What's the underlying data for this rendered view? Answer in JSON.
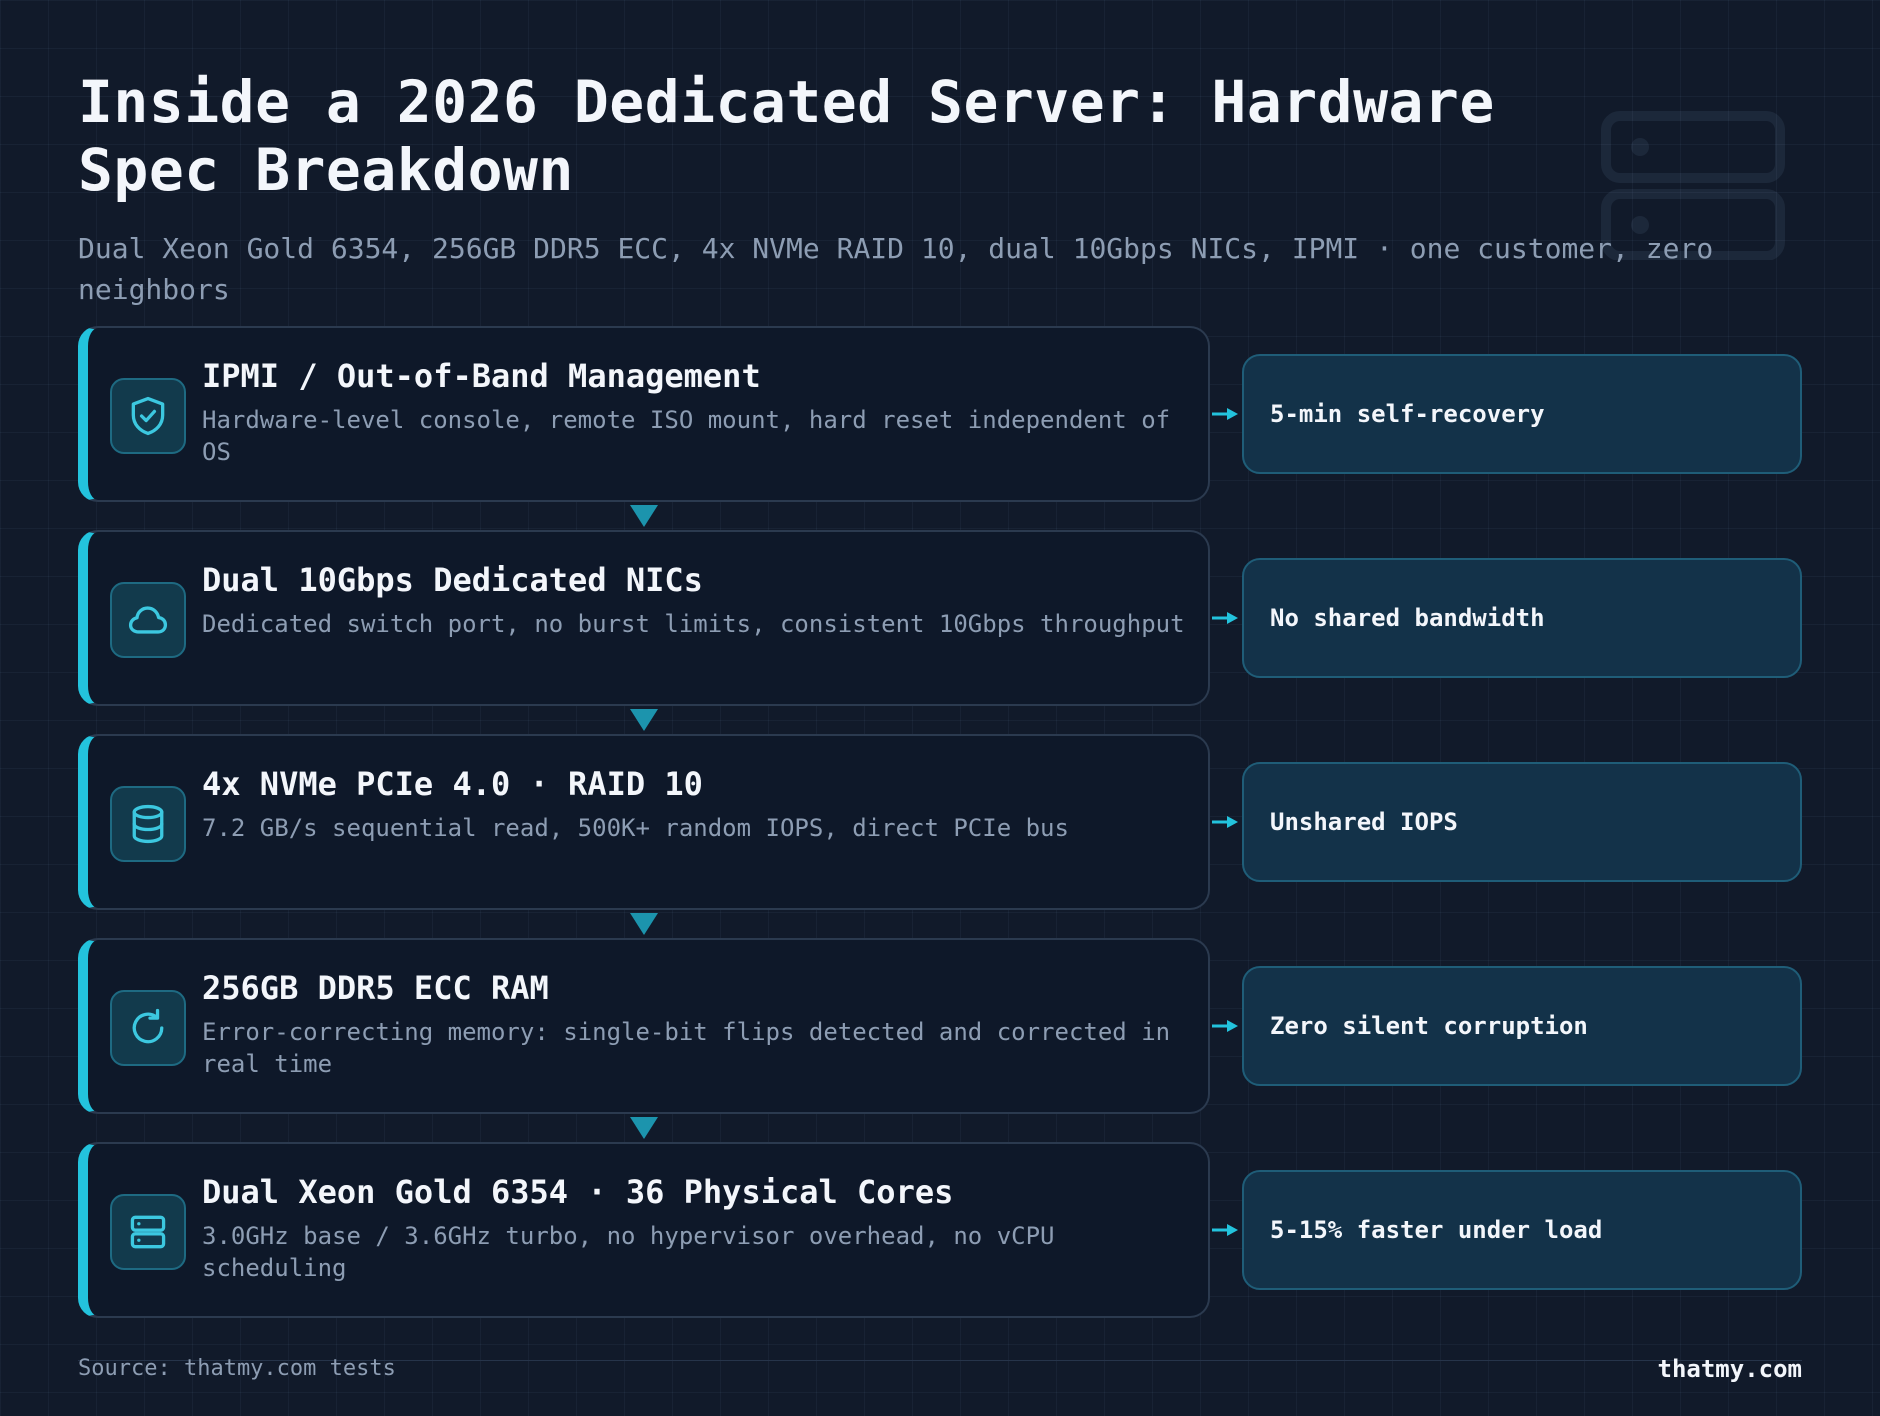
{
  "header": {
    "title": "Inside a 2026 Dedicated Server: Hardware Spec Breakdown",
    "subtitle": "Dual Xeon Gold 6354, 256GB DDR5 ECC, 4x NVMe RAID 10, dual 10Gbps NICs, IPMI · one customer, zero neighbors"
  },
  "layers": [
    {
      "title": "IPMI / Out-of-Band Management",
      "description": "Hardware-level console, remote ISO mount, hard reset independent of OS",
      "benefit": "5-min self-recovery",
      "icon": "shield-check-icon"
    },
    {
      "title": "Dual 10Gbps Dedicated NICs",
      "description": "Dedicated switch port, no burst limits, consistent 10Gbps throughput",
      "benefit": "No shared bandwidth",
      "icon": "cloud-icon"
    },
    {
      "title": "4x NVMe PCIe 4.0 · RAID 10",
      "description": "7.2 GB/s sequential read, 500K+ random IOPS, direct PCIe bus",
      "benefit": "Unshared IOPS",
      "icon": "database-icon"
    },
    {
      "title": "256GB DDR5 ECC RAM",
      "description": "Error-correcting memory: single-bit flips detected and corrected in real time",
      "benefit": "Zero silent corruption",
      "icon": "refresh-icon"
    },
    {
      "title": "Dual Xeon Gold 6354 · 36 Physical Cores",
      "description": "3.0GHz base / 3.6GHz turbo, no hypervisor overhead, no vCPU scheduling",
      "benefit": "5-15% faster under load",
      "icon": "server-icon"
    }
  ],
  "footer": {
    "source": "Source: thatmy.com tests",
    "brand": "thatmy.com"
  },
  "colors": {
    "accent": "#23c3dd",
    "background": "#111a2a",
    "card": "#0e1829",
    "benefit_card": "#133249"
  }
}
